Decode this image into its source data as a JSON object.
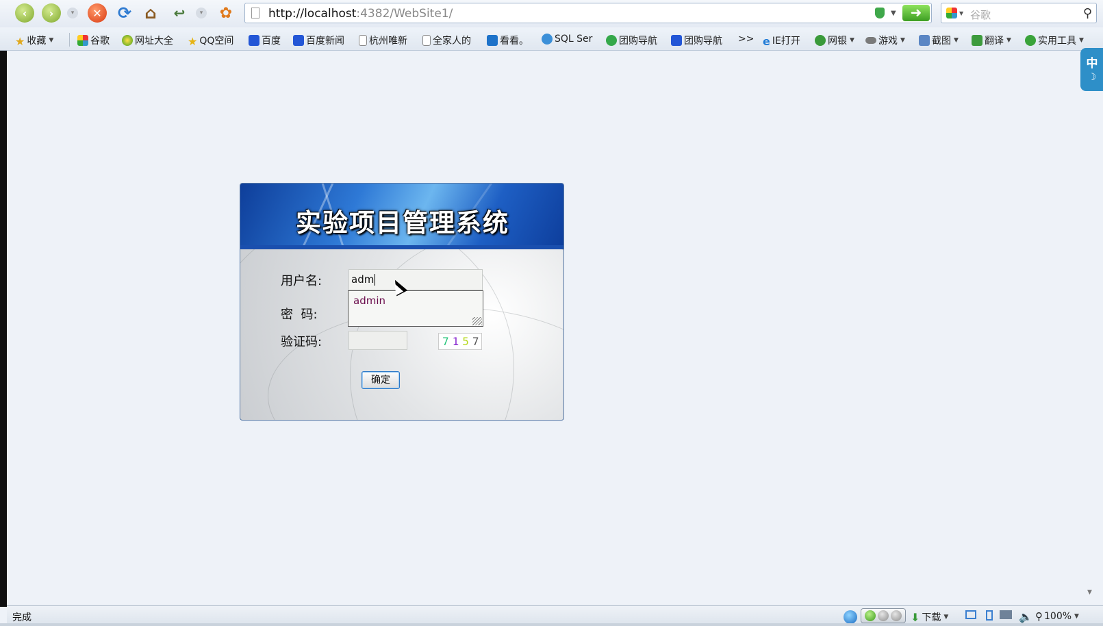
{
  "browser": {
    "url_host": "http://localhost",
    "url_rest": ":4382/WebSite1/",
    "search_placeholder": "谷歌"
  },
  "favorites": [
    {
      "label": "收藏",
      "icon": "star-icon"
    },
    {
      "label": "谷歌",
      "icon": "google-icon"
    },
    {
      "label": "网址大全",
      "icon": "portal-icon"
    },
    {
      "label": "QQ空间",
      "icon": "star-icon"
    },
    {
      "label": "百度",
      "icon": "baidu-paw-icon"
    },
    {
      "label": "百度新闻",
      "icon": "baidu-paw-icon"
    },
    {
      "label": "杭州唯新",
      "icon": "page-icon"
    },
    {
      "label": "全家人的",
      "icon": "page-icon"
    },
    {
      "label": "看看。",
      "icon": "kankan-icon"
    },
    {
      "label": "SQL Ser",
      "icon": "sql-icon"
    },
    {
      "label": "团购导航",
      "icon": "tuan-icon"
    },
    {
      "label": "团购导航",
      "icon": "baidu-paw-icon"
    },
    {
      "label": ">>",
      "icon": ""
    },
    {
      "label": "IE打开",
      "icon": "ie-icon"
    },
    {
      "label": "网银",
      "icon": "bank-icon"
    },
    {
      "label": "游戏",
      "icon": "gamepad-icon"
    },
    {
      "label": "截图",
      "icon": "screenshot-icon"
    },
    {
      "label": "翻译",
      "icon": "translate-icon"
    },
    {
      "label": "实用工具",
      "icon": "plus-icon"
    }
  ],
  "ime": {
    "label": "中",
    "moon": "☽"
  },
  "login": {
    "title": "实验项目管理系统",
    "username_label": "用户名:",
    "username_value": "adm",
    "autocomplete_item": "admin",
    "password_label": "密  码:",
    "captcha_label": "验证码:",
    "captcha": [
      {
        "ch": "7",
        "color": "#25c47a"
      },
      {
        "ch": "1",
        "color": "#8a2ad0"
      },
      {
        "ch": "5",
        "color": "#b6d81e"
      },
      {
        "ch": "7",
        "color": "#555555"
      }
    ],
    "submit_label": "确定"
  },
  "status": {
    "text": "完成",
    "download_label": "下载",
    "zoom": "100%"
  }
}
